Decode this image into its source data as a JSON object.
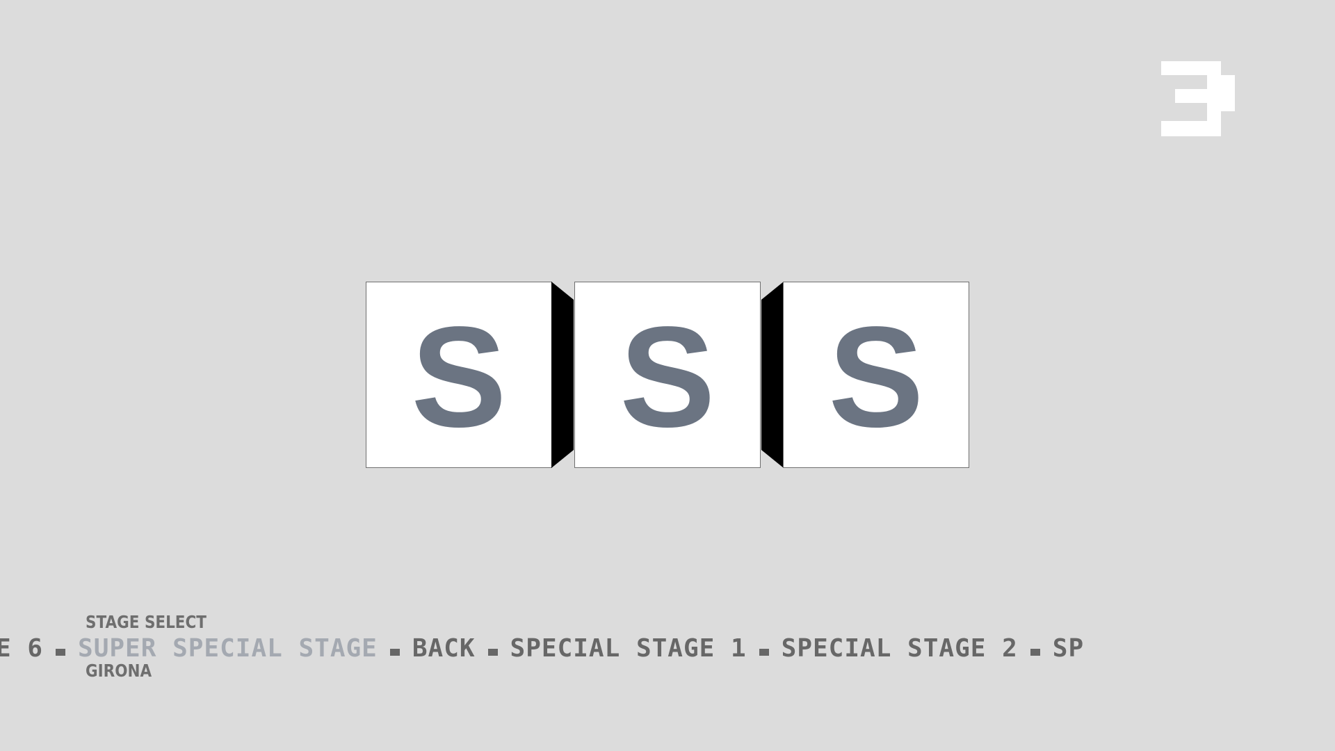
{
  "hud": {
    "counter": "3",
    "counter_color": "#ffffff"
  },
  "cubes": {
    "letters": [
      "S",
      "S",
      "S"
    ],
    "face_color": "#ffffff",
    "letter_color": "#6b7482"
  },
  "menu": {
    "heading": "STAGE SELECT",
    "location": "GIRONA",
    "items": [
      {
        "label": "E 6",
        "active": false
      },
      {
        "label": "SUPER SPECIAL STAGE",
        "active": true
      },
      {
        "label": "BACK",
        "active": false
      },
      {
        "label": "SPECIAL STAGE 1",
        "active": false
      },
      {
        "label": "SPECIAL STAGE 2",
        "active": false
      },
      {
        "label": "SP",
        "active": false
      }
    ],
    "text_color": "#676767",
    "active_color": "#a4a9b1"
  }
}
